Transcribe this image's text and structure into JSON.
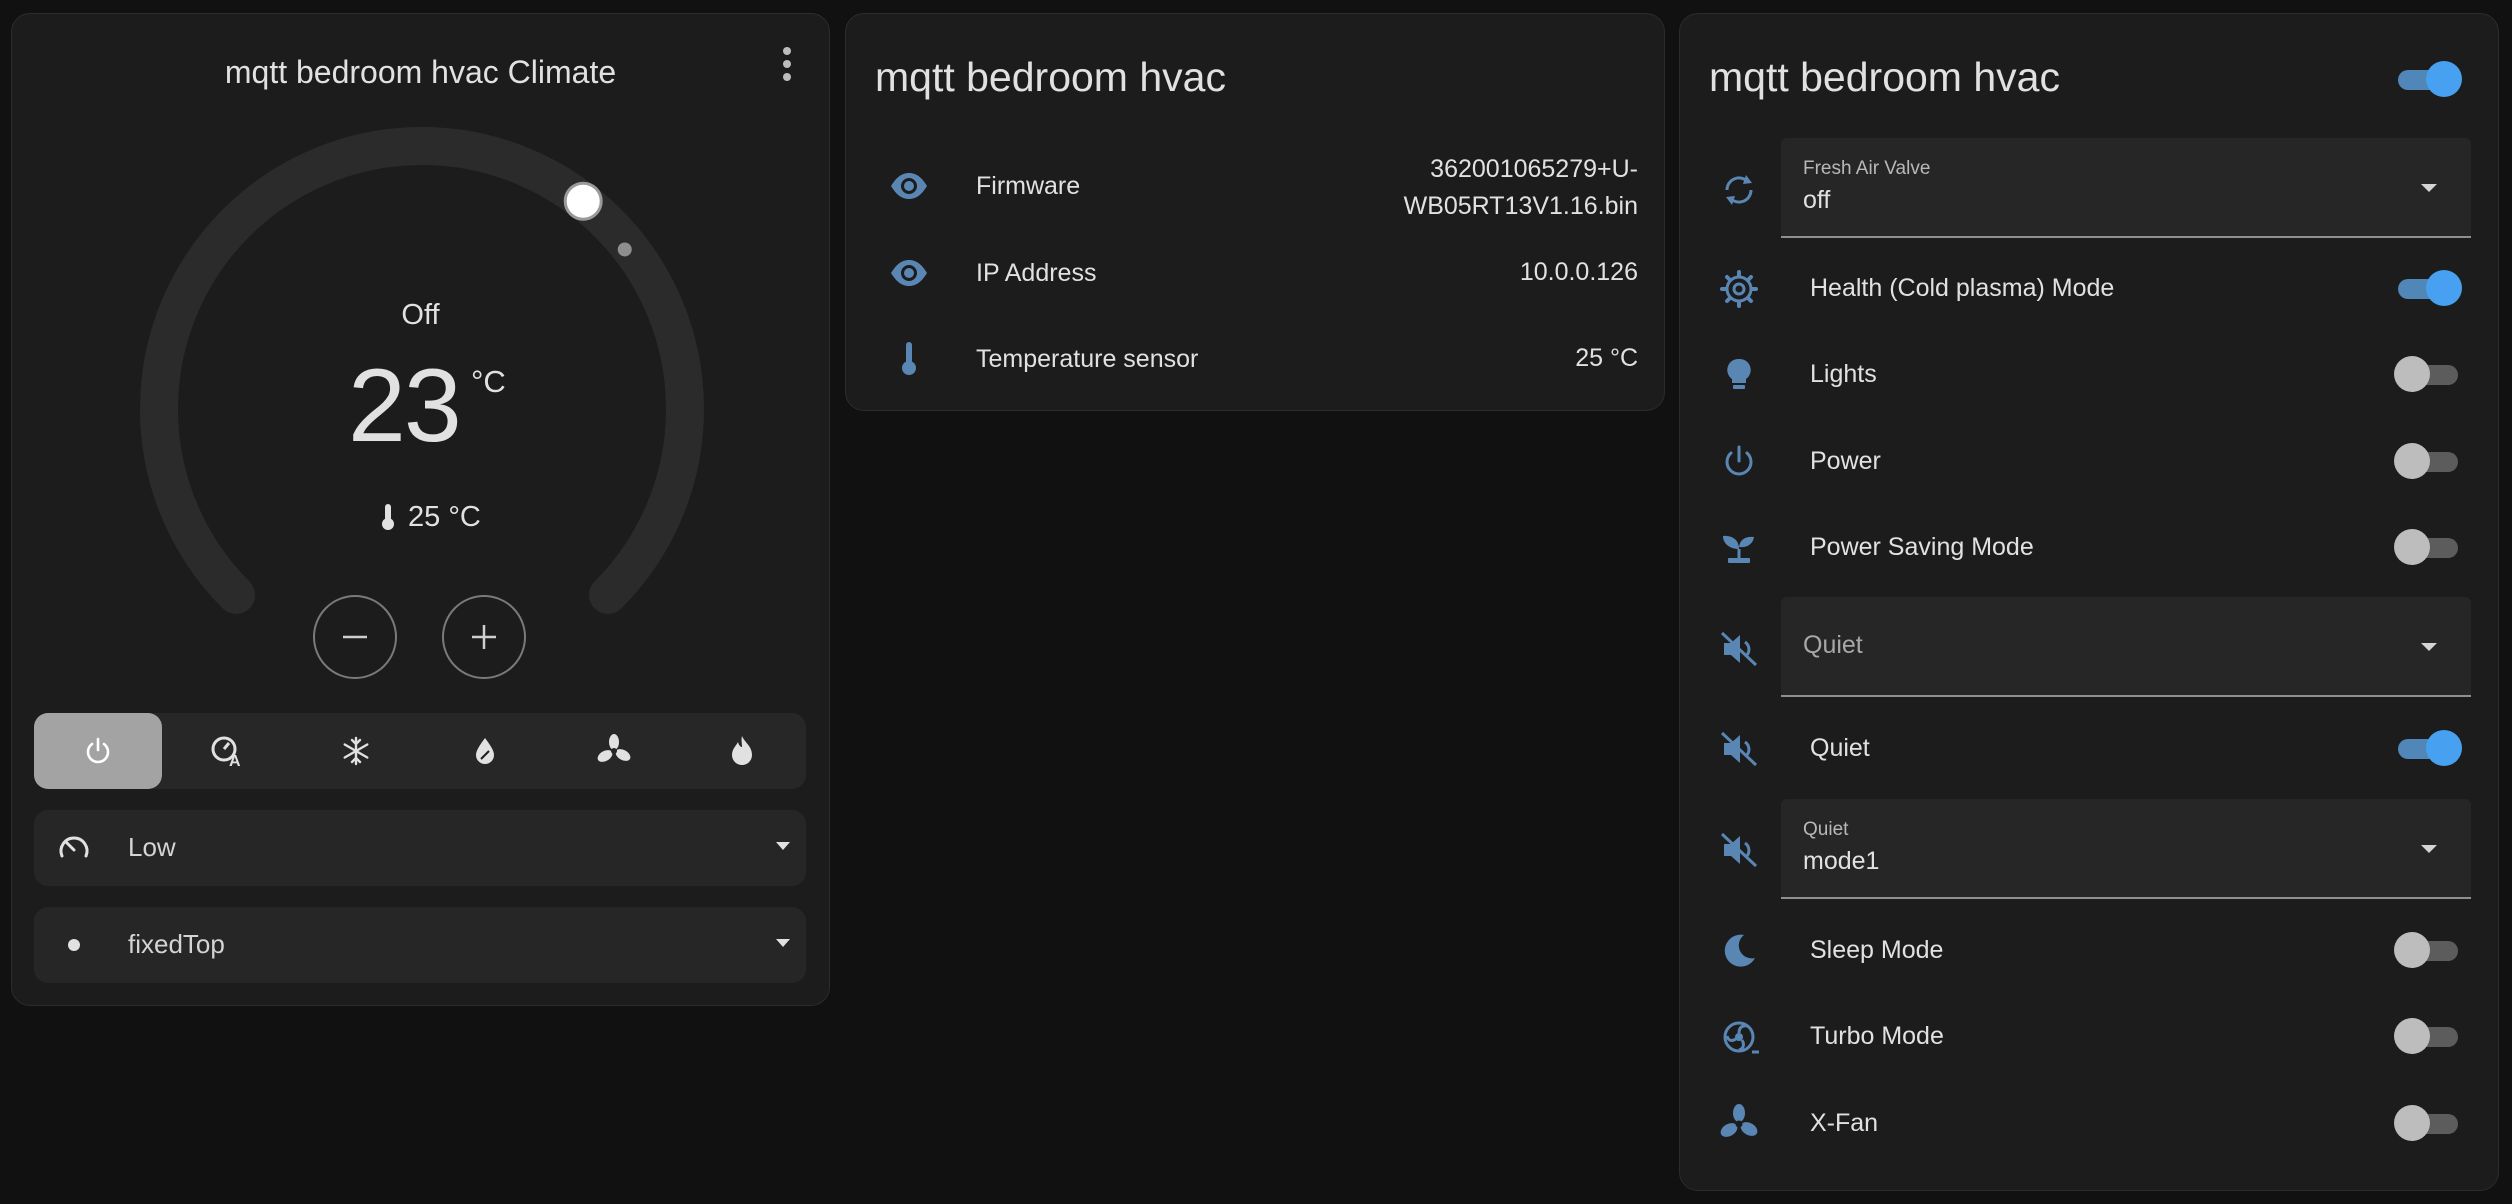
{
  "colors": {
    "accent": "#47a1f0",
    "icon_blue": "#5a86b4",
    "card_bg": "#1c1c1c",
    "page_bg": "#111111"
  },
  "climate_card": {
    "title": "mqtt bedroom hvac Climate",
    "menu_icon": "more-vertical-icon",
    "hvac_state": "Off",
    "target_temperature": "23",
    "unit": "°C",
    "current_temperature": "25 °C",
    "thermostat_fraction": 0.64,
    "modes": [
      {
        "name": "off",
        "icon": "power-icon",
        "active": true
      },
      {
        "name": "auto",
        "icon": "thermostat-auto-icon",
        "active": false
      },
      {
        "name": "cool",
        "icon": "snowflake-icon",
        "active": false
      },
      {
        "name": "dry",
        "icon": "water-percent-icon",
        "active": false
      },
      {
        "name": "fan_only",
        "icon": "fan-icon",
        "active": false
      },
      {
        "name": "heat",
        "icon": "fire-icon",
        "active": false
      }
    ],
    "fan_mode": {
      "value": "Low",
      "icon": "fan-speed-icon"
    },
    "swing_mode": {
      "value": "fixedTop",
      "icon": "dot-icon"
    }
  },
  "info_card": {
    "title": "mqtt bedroom hvac",
    "rows": [
      {
        "label": "Firmware",
        "value_line1": "362001065279+U-",
        "value_line2": "WB05RT13V1.16.bin",
        "icon": "eye-icon"
      },
      {
        "label": "IP Address",
        "value": "10.0.0.126",
        "icon": "eye-icon"
      },
      {
        "label": "Temperature sensor",
        "value": "25 °C",
        "icon": "thermometer-icon"
      }
    ]
  },
  "controls_card": {
    "title": "mqtt bedroom hvac",
    "header_toggle_on": true,
    "fresh_air": {
      "label": "Fresh Air Valve",
      "value": "off",
      "icon": "sync-icon"
    },
    "health_mode": {
      "label": "Health (Cold plasma) Mode",
      "on": true,
      "icon": "cog-icon"
    },
    "lights": {
      "label": "Lights",
      "on": false,
      "icon": "lightbulb-icon"
    },
    "power": {
      "label": "Power",
      "on": false,
      "icon": "power-icon"
    },
    "power_saving": {
      "label": "Power Saving Mode",
      "on": false,
      "icon": "sprout-icon"
    },
    "quiet_select": {
      "placeholder": "Quiet",
      "icon": "volume-off-icon"
    },
    "quiet_toggle": {
      "label": "Quiet",
      "on": true,
      "icon": "volume-off-icon"
    },
    "quiet_mode": {
      "label": "Quiet",
      "value": "mode1",
      "icon": "volume-off-icon"
    },
    "sleep_mode": {
      "label": "Sleep Mode",
      "on": false,
      "icon": "moon-icon"
    },
    "turbo_mode": {
      "label": "Turbo Mode",
      "on": false,
      "icon": "turbo-fan-icon"
    },
    "xfan": {
      "label": "X-Fan",
      "on": false,
      "icon": "fan-icon"
    }
  }
}
